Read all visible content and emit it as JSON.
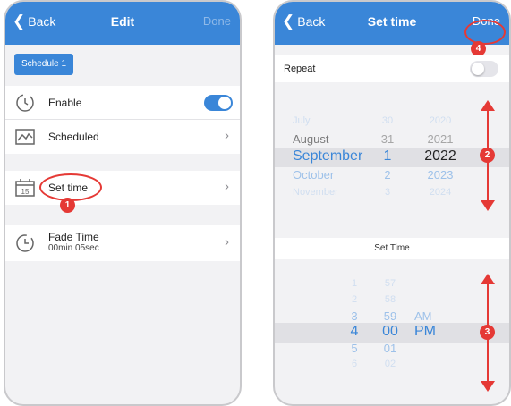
{
  "left": {
    "nav": {
      "back": "Back",
      "title": "Edit",
      "done": "Done"
    },
    "schedule_chip": "Schedule 1",
    "rows": {
      "enable": "Enable",
      "scheduled": "Scheduled",
      "set_time": "Set time",
      "fade_time": "Fade Time",
      "fade_value": "00min 05sec"
    },
    "markers": {
      "set_time": "1"
    }
  },
  "right": {
    "nav": {
      "back": "Back",
      "title": "Set time",
      "done": "Done"
    },
    "repeat": "Repeat",
    "date_picker": {
      "months": [
        "July",
        "August",
        "September",
        "October",
        "November"
      ],
      "days": [
        "30",
        "31",
        "1",
        "2",
        "3"
      ],
      "years": [
        "2020",
        "2021",
        "2022",
        "2023",
        "2024"
      ]
    },
    "set_time_label": "Set Time",
    "time_picker": {
      "hours": [
        "1",
        "2",
        "3",
        "4",
        "5",
        "6"
      ],
      "minutes": [
        "57",
        "58",
        "59",
        "00",
        "01",
        "02"
      ],
      "ampm": [
        "AM",
        "PM"
      ]
    },
    "markers": {
      "date": "2",
      "time": "3",
      "done": "4"
    }
  },
  "colors": {
    "accent": "#3a86d8",
    "marker": "#e53935",
    "band": "#e0e0e4"
  },
  "icons": [
    "chevron-left-icon",
    "timer-icon",
    "chart-icon",
    "calendar-icon",
    "fade-timer-icon",
    "chevron-right-icon"
  ]
}
